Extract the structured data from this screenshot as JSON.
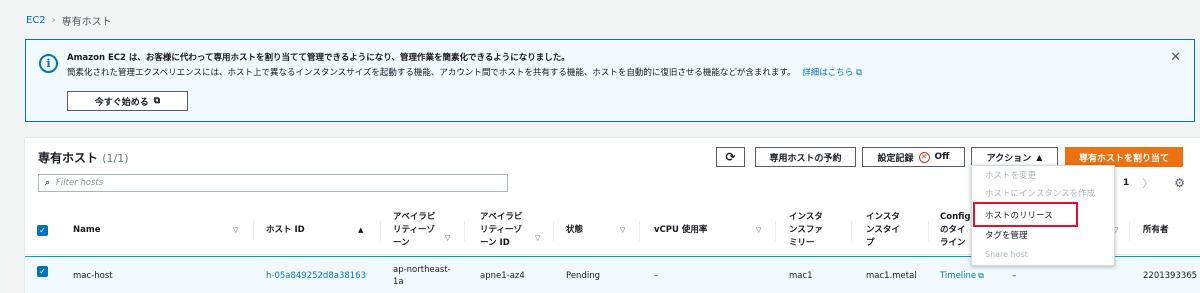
{
  "breadcrumb": {
    "root": "EC2",
    "current": "専有ホスト"
  },
  "banner": {
    "title": "Amazon EC2 は、お客様に代わって専用ホストを割り当てて管理できるようになり、管理作業を簡素化できるようになりました。",
    "description": "簡素化された管理エクスペリエンスには、ホスト上で異なるインスタンスサイズを起動する機能、アカウント間でホストを共有する機能、ホストを自動的に復旧させる機能などが含まれます。",
    "learn_more": "詳細はこちら",
    "start_button": "今すぐ始める"
  },
  "panel": {
    "title": "専有ホスト",
    "count": "(1/1)",
    "reserve_button": "専用ホストの予約",
    "settings_label": "設定記録",
    "settings_state": "Off",
    "actions_button": "アクション",
    "allocate_button": "専有ホストを割り当て",
    "search_placeholder": "Filter hosts",
    "page": "1"
  },
  "table": {
    "columns": [
      {
        "label": "Name"
      },
      {
        "label": "ホスト ID"
      },
      {
        "label": "アベイラビ\nリティーゾ\nーン"
      },
      {
        "label": "アベイラビ\nリティーゾ\nーン ID"
      },
      {
        "label": "状態"
      },
      {
        "label": "vCPU 使用率"
      },
      {
        "label": "インスタ\nンスファ\nミリー"
      },
      {
        "label": "インスタ\nンスタイ\nプ"
      },
      {
        "label": "Config\nのタイ\nライン"
      },
      {
        "label": "所有者"
      }
    ],
    "row": {
      "name": "mac-host",
      "host_id": "h-05a849252d8a38163",
      "az": "ap-northeast-\n1a",
      "az_id": "apne1-az4",
      "state": "Pending",
      "vcpu": "–",
      "family": "mac1",
      "type": "mac1.metal",
      "timeline": "Timeline",
      "extra": "–",
      "owner": "2201393365"
    }
  },
  "actions_menu": {
    "items": [
      {
        "label": "ホストを変更",
        "disabled": true
      },
      {
        "label": "ホストにインスタンスを作成",
        "disabled": true
      },
      {
        "label": "ホストのリリース",
        "disabled": false
      },
      {
        "label": "タグを管理",
        "disabled": false
      },
      {
        "label": "Share host",
        "disabled": true
      }
    ]
  },
  "colors": {
    "accent": "#0073bb",
    "primary_button": "#ec7211",
    "highlight": "#e0112b"
  },
  "icons": [
    "info-icon",
    "close-icon",
    "external-link-icon",
    "refresh-icon",
    "off-status-icon",
    "caret-up-icon",
    "search-icon",
    "chevron-right-icon",
    "gear-icon",
    "sort-icon",
    "checkbox-checked-icon"
  ]
}
